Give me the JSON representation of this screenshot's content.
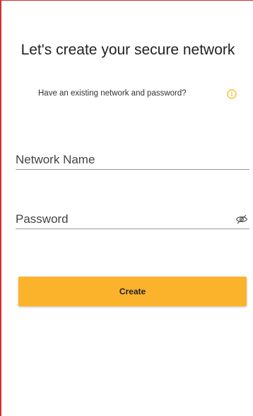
{
  "header": {
    "title": "Let's create your secure network",
    "subtitle": "Have an existing network and password?",
    "info_icon": "info-circle-icon"
  },
  "form": {
    "network_name": {
      "value": "",
      "placeholder": "Network Name"
    },
    "password": {
      "value": "",
      "placeholder": "Password",
      "toggle_icon": "eye-slash-icon"
    }
  },
  "actions": {
    "create_label": "Create"
  },
  "colors": {
    "accent": "#fbb32c",
    "info_icon": "#f5b400",
    "frame_border": "#d32f2f"
  }
}
